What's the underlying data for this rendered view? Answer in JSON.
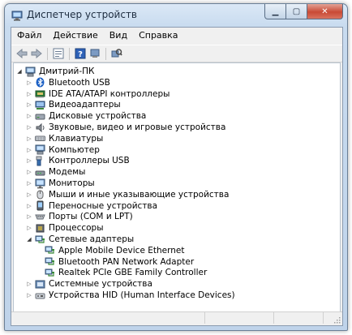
{
  "window": {
    "title": "Диспетчер устройств"
  },
  "menu": [
    "Файл",
    "Действие",
    "Вид",
    "Справка"
  ],
  "toolbar": {
    "buttons": [
      "back-icon",
      "forward-icon",
      "properties-icon",
      "help-icon",
      "scan-hardware-icon",
      "device-icon"
    ]
  },
  "tree": {
    "root": {
      "label": "Дмитрий-ПК",
      "icon": "computer-icon",
      "expanded": true
    },
    "categories": [
      {
        "label": "Bluetooth USB",
        "icon": "bluetooth-icon"
      },
      {
        "label": "IDE ATA/ATAPI контроллеры",
        "icon": "ide-controller-icon"
      },
      {
        "label": "Видеоадаптеры",
        "icon": "display-adapter-icon"
      },
      {
        "label": "Дисковые устройства",
        "icon": "disk-drive-icon"
      },
      {
        "label": "Звуковые, видео и игровые устройства",
        "icon": "sound-icon"
      },
      {
        "label": "Клавиатуры",
        "icon": "keyboard-icon"
      },
      {
        "label": "Компьютер",
        "icon": "computer-icon"
      },
      {
        "label": "Контроллеры USB",
        "icon": "usb-icon"
      },
      {
        "label": "Модемы",
        "icon": "modem-icon"
      },
      {
        "label": "Мониторы",
        "icon": "monitor-icon"
      },
      {
        "label": "Мыши и иные указывающие устройства",
        "icon": "mouse-icon"
      },
      {
        "label": "Переносные устройства",
        "icon": "portable-device-icon"
      },
      {
        "label": "Порты (COM и LPT)",
        "icon": "port-icon"
      },
      {
        "label": "Процессоры",
        "icon": "processor-icon"
      },
      {
        "label": "Сетевые адаптеры",
        "icon": "network-adapter-icon",
        "expanded": true,
        "children": [
          {
            "label": "Apple Mobile Device Ethernet",
            "icon": "network-adapter-icon"
          },
          {
            "label": "Bluetooth PAN Network Adapter",
            "icon": "network-adapter-icon"
          },
          {
            "label": "Realtek PCIe GBE Family Controller",
            "icon": "network-adapter-icon"
          }
        ]
      },
      {
        "label": "Системные устройства",
        "icon": "system-device-icon"
      },
      {
        "label": "Устройства HID (Human Interface Devices)",
        "icon": "hid-icon"
      }
    ]
  },
  "colors": {
    "title_bar": "#c8dbef",
    "close_button": "#c94a35",
    "bluetooth": "#1a5fc4"
  }
}
